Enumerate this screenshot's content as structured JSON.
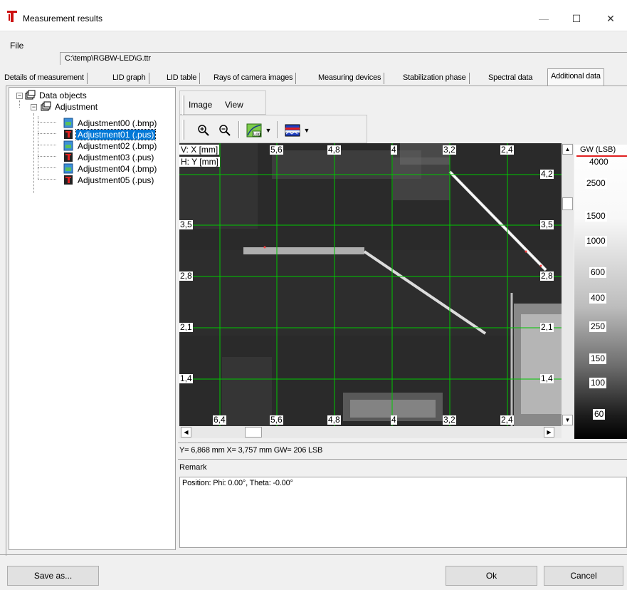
{
  "window": {
    "title": "Measurement results",
    "minimize": "—",
    "maximize": "☐",
    "close": "✕"
  },
  "file": {
    "label": "File",
    "value": "C:\\temp\\RGBW-LED\\G.ttr"
  },
  "tabs": [
    "Details of measurement",
    "LID graph",
    "LID table",
    "Rays of camera images",
    "Measuring devices",
    "Stabilization phase",
    "Spectral data",
    "Additional data"
  ],
  "tree": {
    "root": "Data objects",
    "group": "Adjustment",
    "items": [
      {
        "label": "Adjustment00 (.bmp)",
        "type": "bmp"
      },
      {
        "label": "Adjustment01 (.pus)",
        "type": "pus",
        "selected": true
      },
      {
        "label": "Adjustment02 (.bmp)",
        "type": "bmp"
      },
      {
        "label": "Adjustment03 (.pus)",
        "type": "pus"
      },
      {
        "label": "Adjustment04 (.bmp)",
        "type": "bmp"
      },
      {
        "label": "Adjustment05 (.pus)",
        "type": "pus"
      }
    ]
  },
  "menu": {
    "image": "Image",
    "view": "View"
  },
  "toolbar_icons": [
    "zoom-in-icon",
    "zoom-out-icon",
    "log-scale-icon",
    "palette-icon"
  ],
  "image_view": {
    "v_axis_label": "V: X [mm]",
    "h_axis_label": "H: Y [mm]",
    "top_ticks": [
      "5,6",
      "4,8",
      "4",
      "3,2",
      "2,4"
    ],
    "bottom_ticks": [
      "6,4",
      "5,6",
      "4,8",
      "4",
      "3,2",
      "2,4"
    ],
    "left_ticks": [
      "3,5",
      "2,8",
      "2,1",
      "1,4"
    ],
    "right_ticks": [
      "4,2",
      "3,5",
      "2,8",
      "2,1",
      "1,4"
    ],
    "grid_color": "#00c800"
  },
  "colorbar": {
    "title": "GW (LSB)",
    "values": [
      "4000",
      "2500",
      "1500",
      "1000",
      "600",
      "400",
      "250",
      "150",
      "100",
      "60"
    ]
  },
  "status": "Y= 6,868 mm  X= 3,757 mm  GW= 206 LSB",
  "remark": {
    "label": "Remark",
    "text": "Position: Phi: 0.00°, Theta: -0.00°"
  },
  "buttons": {
    "save_as": "Save as...",
    "ok": "Ok",
    "cancel": "Cancel"
  }
}
